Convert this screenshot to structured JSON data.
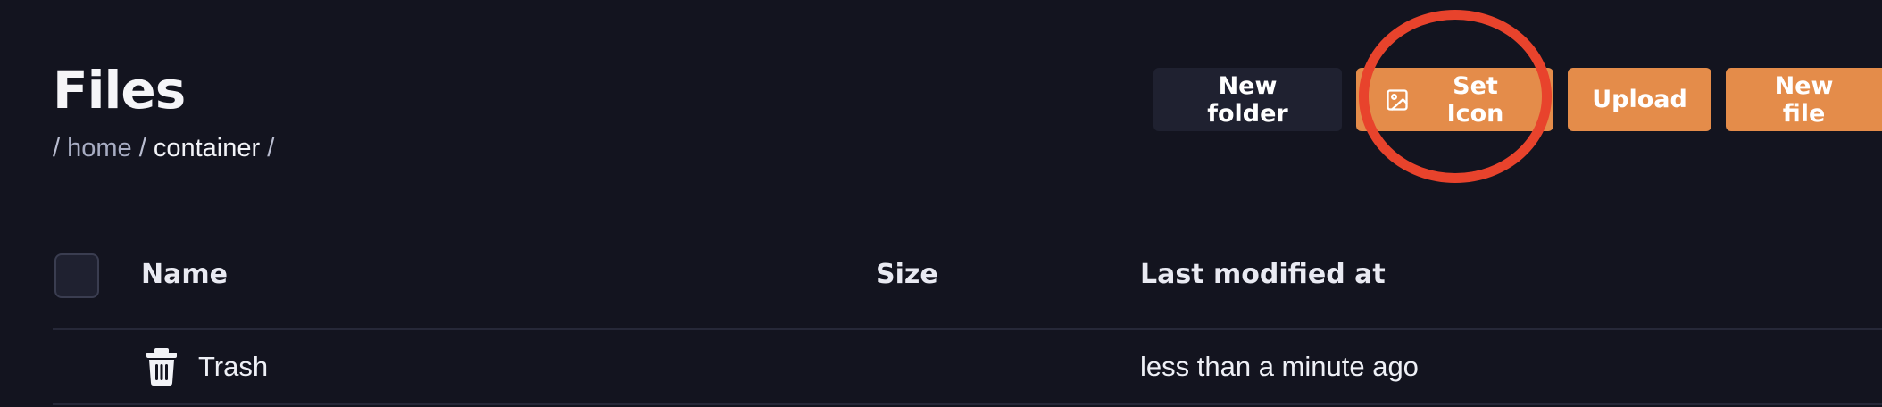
{
  "page": {
    "title": "Files"
  },
  "breadcrumb": {
    "separator": "/",
    "items": [
      "home",
      "container"
    ]
  },
  "toolbar": {
    "new_folder_label": "New folder",
    "set_icon_label": "Set Icon",
    "upload_label": "Upload",
    "new_file_label": "New file"
  },
  "table": {
    "columns": {
      "name": "Name",
      "size": "Size",
      "modified": "Last modified at"
    },
    "rows": [
      {
        "icon": "trash-icon",
        "name": "Trash",
        "size": "",
        "modified": "less than a minute ago"
      }
    ]
  },
  "colors": {
    "background": "#13141f",
    "accent": "#e48c4a",
    "secondary_button": "#1f2130",
    "annotation": "#e8432c"
  }
}
